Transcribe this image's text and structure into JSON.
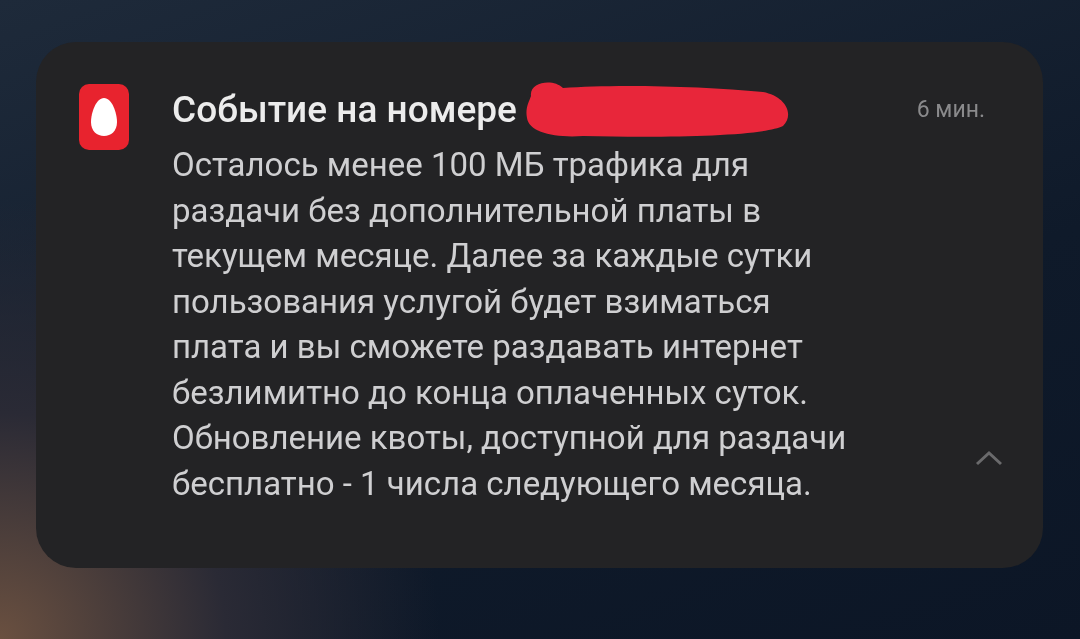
{
  "notification": {
    "title": "Событие на номере",
    "redacted": true,
    "time": "6 мин.",
    "body": "Осталось менее 100 МБ трафика для\nраздачи без дополнительной платы в\nтекущем месяце. Далее за каждые сутки\nпользования услугой будет взиматься\nплата и вы сможете раздавать интернет\nбезлимитно до конца оплаченных суток.\nОбновление квоты, доступной для раздачи\nбесплатно - 1 числа следующего месяца.",
    "expanded": true
  }
}
